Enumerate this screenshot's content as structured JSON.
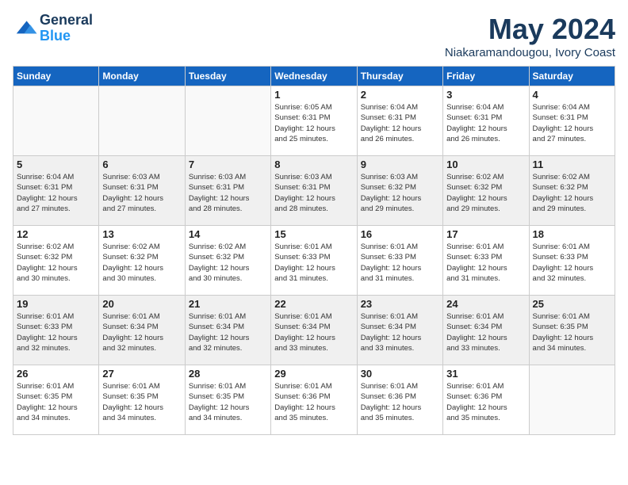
{
  "header": {
    "logo_line1": "General",
    "logo_line2": "Blue",
    "month_title": "May 2024",
    "location": "Niakaramandougou, Ivory Coast"
  },
  "weekdays": [
    "Sunday",
    "Monday",
    "Tuesday",
    "Wednesday",
    "Thursday",
    "Friday",
    "Saturday"
  ],
  "weeks": [
    [
      {
        "day": "",
        "info": "",
        "empty": true
      },
      {
        "day": "",
        "info": "",
        "empty": true
      },
      {
        "day": "",
        "info": "",
        "empty": true
      },
      {
        "day": "1",
        "info": "Sunrise: 6:05 AM\nSunset: 6:31 PM\nDaylight: 12 hours\nand 25 minutes."
      },
      {
        "day": "2",
        "info": "Sunrise: 6:04 AM\nSunset: 6:31 PM\nDaylight: 12 hours\nand 26 minutes."
      },
      {
        "day": "3",
        "info": "Sunrise: 6:04 AM\nSunset: 6:31 PM\nDaylight: 12 hours\nand 26 minutes."
      },
      {
        "day": "4",
        "info": "Sunrise: 6:04 AM\nSunset: 6:31 PM\nDaylight: 12 hours\nand 27 minutes."
      }
    ],
    [
      {
        "day": "5",
        "info": "Sunrise: 6:04 AM\nSunset: 6:31 PM\nDaylight: 12 hours\nand 27 minutes."
      },
      {
        "day": "6",
        "info": "Sunrise: 6:03 AM\nSunset: 6:31 PM\nDaylight: 12 hours\nand 27 minutes."
      },
      {
        "day": "7",
        "info": "Sunrise: 6:03 AM\nSunset: 6:31 PM\nDaylight: 12 hours\nand 28 minutes."
      },
      {
        "day": "8",
        "info": "Sunrise: 6:03 AM\nSunset: 6:31 PM\nDaylight: 12 hours\nand 28 minutes."
      },
      {
        "day": "9",
        "info": "Sunrise: 6:03 AM\nSunset: 6:32 PM\nDaylight: 12 hours\nand 29 minutes."
      },
      {
        "day": "10",
        "info": "Sunrise: 6:02 AM\nSunset: 6:32 PM\nDaylight: 12 hours\nand 29 minutes."
      },
      {
        "day": "11",
        "info": "Sunrise: 6:02 AM\nSunset: 6:32 PM\nDaylight: 12 hours\nand 29 minutes."
      }
    ],
    [
      {
        "day": "12",
        "info": "Sunrise: 6:02 AM\nSunset: 6:32 PM\nDaylight: 12 hours\nand 30 minutes."
      },
      {
        "day": "13",
        "info": "Sunrise: 6:02 AM\nSunset: 6:32 PM\nDaylight: 12 hours\nand 30 minutes."
      },
      {
        "day": "14",
        "info": "Sunrise: 6:02 AM\nSunset: 6:32 PM\nDaylight: 12 hours\nand 30 minutes."
      },
      {
        "day": "15",
        "info": "Sunrise: 6:01 AM\nSunset: 6:33 PM\nDaylight: 12 hours\nand 31 minutes."
      },
      {
        "day": "16",
        "info": "Sunrise: 6:01 AM\nSunset: 6:33 PM\nDaylight: 12 hours\nand 31 minutes."
      },
      {
        "day": "17",
        "info": "Sunrise: 6:01 AM\nSunset: 6:33 PM\nDaylight: 12 hours\nand 31 minutes."
      },
      {
        "day": "18",
        "info": "Sunrise: 6:01 AM\nSunset: 6:33 PM\nDaylight: 12 hours\nand 32 minutes."
      }
    ],
    [
      {
        "day": "19",
        "info": "Sunrise: 6:01 AM\nSunset: 6:33 PM\nDaylight: 12 hours\nand 32 minutes."
      },
      {
        "day": "20",
        "info": "Sunrise: 6:01 AM\nSunset: 6:34 PM\nDaylight: 12 hours\nand 32 minutes."
      },
      {
        "day": "21",
        "info": "Sunrise: 6:01 AM\nSunset: 6:34 PM\nDaylight: 12 hours\nand 32 minutes."
      },
      {
        "day": "22",
        "info": "Sunrise: 6:01 AM\nSunset: 6:34 PM\nDaylight: 12 hours\nand 33 minutes."
      },
      {
        "day": "23",
        "info": "Sunrise: 6:01 AM\nSunset: 6:34 PM\nDaylight: 12 hours\nand 33 minutes."
      },
      {
        "day": "24",
        "info": "Sunrise: 6:01 AM\nSunset: 6:34 PM\nDaylight: 12 hours\nand 33 minutes."
      },
      {
        "day": "25",
        "info": "Sunrise: 6:01 AM\nSunset: 6:35 PM\nDaylight: 12 hours\nand 34 minutes."
      }
    ],
    [
      {
        "day": "26",
        "info": "Sunrise: 6:01 AM\nSunset: 6:35 PM\nDaylight: 12 hours\nand 34 minutes."
      },
      {
        "day": "27",
        "info": "Sunrise: 6:01 AM\nSunset: 6:35 PM\nDaylight: 12 hours\nand 34 minutes."
      },
      {
        "day": "28",
        "info": "Sunrise: 6:01 AM\nSunset: 6:35 PM\nDaylight: 12 hours\nand 34 minutes."
      },
      {
        "day": "29",
        "info": "Sunrise: 6:01 AM\nSunset: 6:36 PM\nDaylight: 12 hours\nand 35 minutes."
      },
      {
        "day": "30",
        "info": "Sunrise: 6:01 AM\nSunset: 6:36 PM\nDaylight: 12 hours\nand 35 minutes."
      },
      {
        "day": "31",
        "info": "Sunrise: 6:01 AM\nSunset: 6:36 PM\nDaylight: 12 hours\nand 35 minutes."
      },
      {
        "day": "",
        "info": "",
        "empty": true
      }
    ]
  ]
}
